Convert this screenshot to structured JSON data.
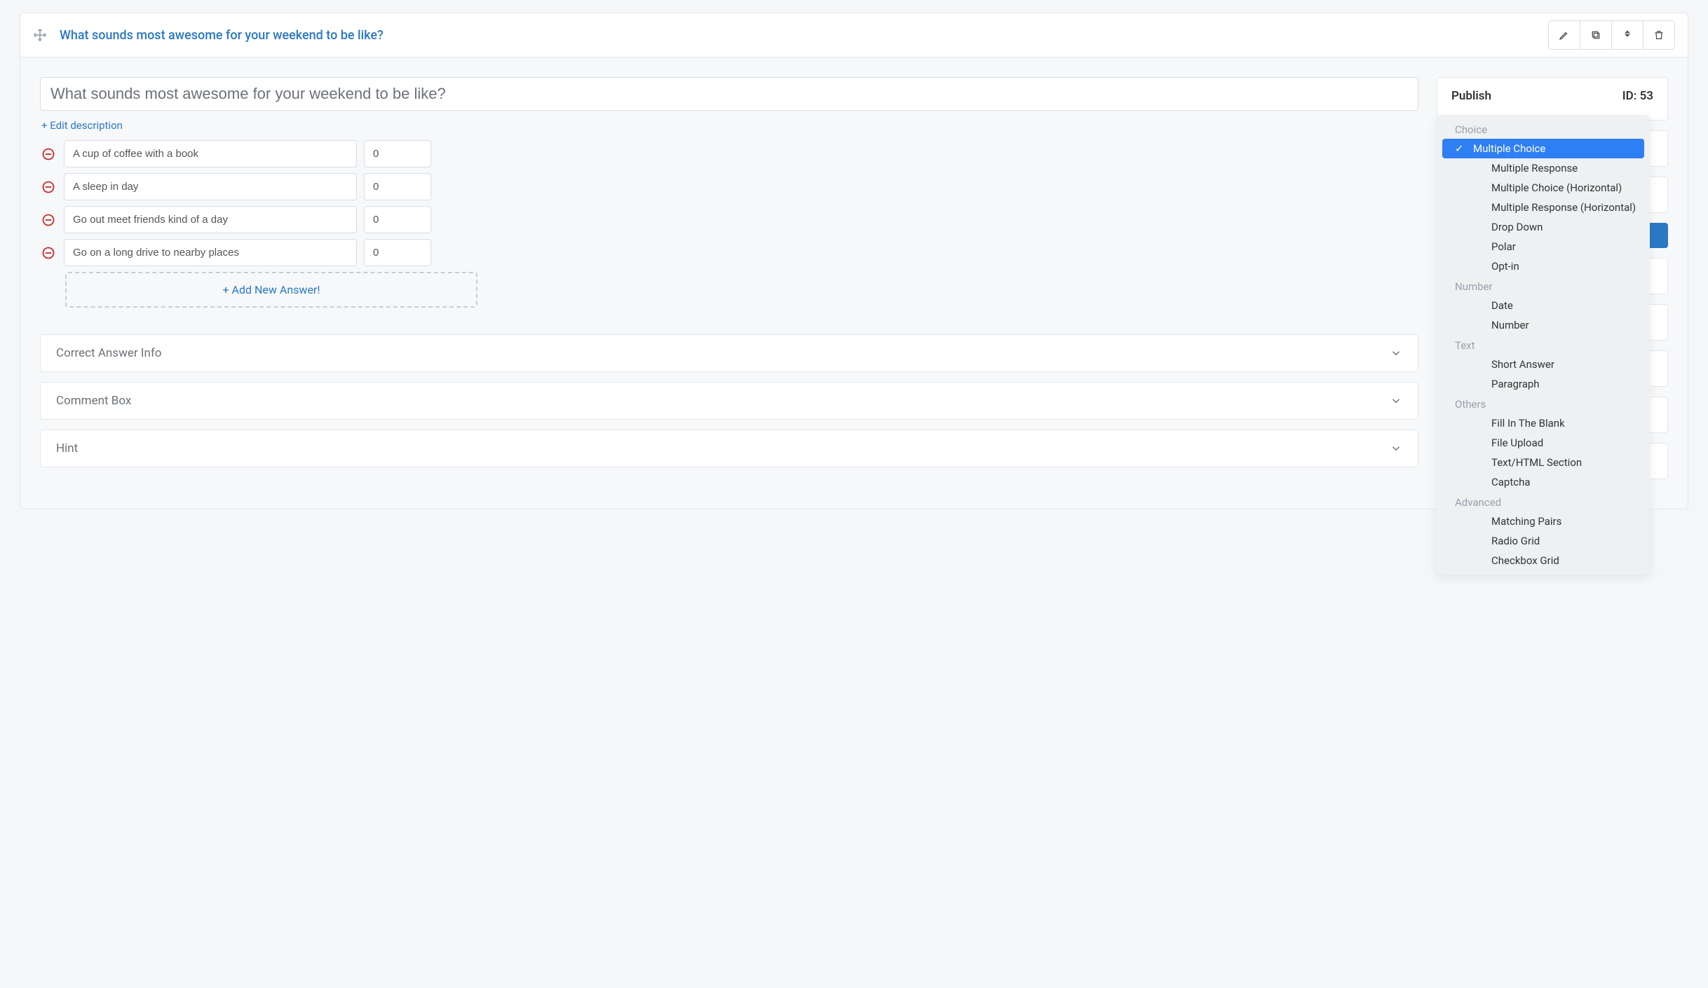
{
  "header": {
    "title": "What sounds most awesome for your weekend to be like?"
  },
  "question": {
    "value": "What sounds most awesome for your weekend to be like?",
    "edit_description": "+ Edit description"
  },
  "answers": [
    {
      "text": "A cup of coffee with a book",
      "score": "0"
    },
    {
      "text": "A sleep in day",
      "score": "0"
    },
    {
      "text": "Go out meet friends kind of a day",
      "score": "0"
    },
    {
      "text": "Go on a long drive to nearby places",
      "score": "0"
    }
  ],
  "add_answer_label": "+ Add New Answer!",
  "accordion": {
    "correct_answer_info": "Correct Answer Info",
    "comment_box": "Comment Box",
    "hint": "Hint"
  },
  "publish": {
    "label": "Publish",
    "id_label": "ID: 53"
  },
  "type_dropdown": {
    "groups": [
      {
        "label": "Choice",
        "items": [
          {
            "label": "Multiple Choice",
            "selected": true
          },
          {
            "label": "Multiple Response"
          },
          {
            "label": "Multiple Choice (Horizontal)"
          },
          {
            "label": "Multiple Response (Horizontal)"
          },
          {
            "label": "Drop Down"
          },
          {
            "label": "Polar"
          },
          {
            "label": "Opt-in"
          }
        ]
      },
      {
        "label": "Number",
        "items": [
          {
            "label": "Date"
          },
          {
            "label": "Number"
          }
        ]
      },
      {
        "label": "Text",
        "items": [
          {
            "label": "Short Answer"
          },
          {
            "label": "Paragraph"
          }
        ]
      },
      {
        "label": "Others",
        "items": [
          {
            "label": "Fill In The Blank"
          },
          {
            "label": "File Upload"
          },
          {
            "label": "Text/HTML Section"
          },
          {
            "label": "Captcha"
          }
        ]
      },
      {
        "label": "Advanced",
        "items": [
          {
            "label": "Matching Pairs"
          },
          {
            "label": "Radio Grid"
          },
          {
            "label": "Checkbox Grid"
          }
        ]
      }
    ]
  }
}
